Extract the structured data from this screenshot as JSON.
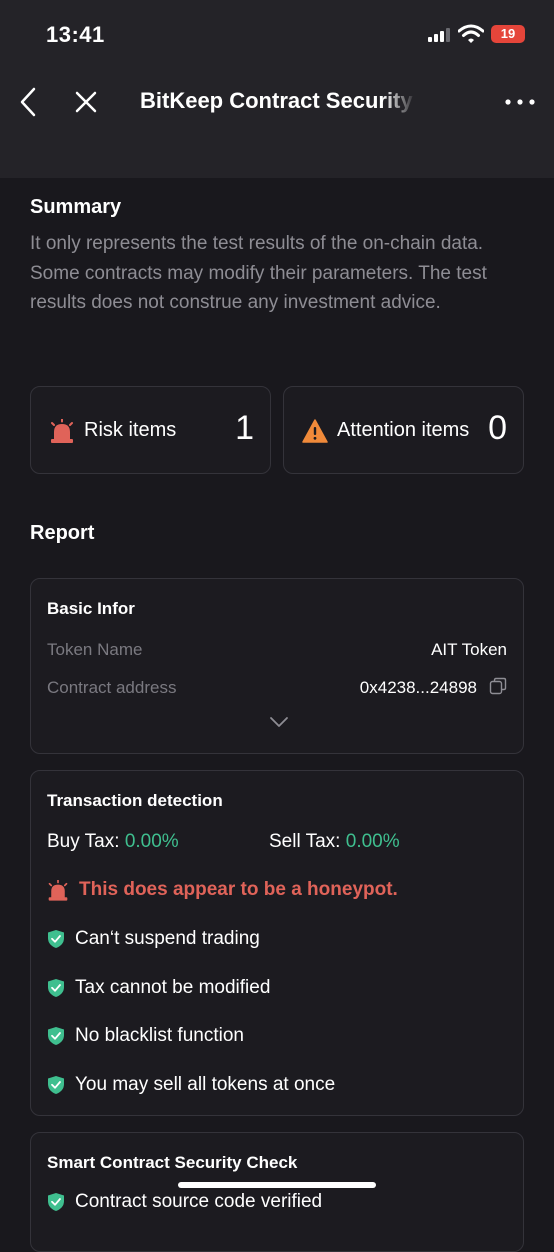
{
  "status": {
    "time": "13:41",
    "battery": "19"
  },
  "nav": {
    "title": "BitKeep Contract Security"
  },
  "summary": {
    "title": "Summary",
    "text": "It only represents the test results of the on-chain data. Some contracts may modify their parameters. The test results does not construe any investment advice."
  },
  "counts": {
    "risk_label": "Risk items",
    "risk_count": "1",
    "attention_label": "Attention items",
    "attention_count": "0"
  },
  "report": {
    "title": "Report"
  },
  "basic": {
    "title": "Basic Infor",
    "token_name_label": "Token Name",
    "token_name_value": "AIT Token",
    "contract_label": "Contract address",
    "contract_value": "0x4238...24898"
  },
  "tx": {
    "title": "Transaction detection",
    "buy_label": "Buy Tax:",
    "buy_value": "0.00%",
    "sell_label": "Sell Tax:",
    "sell_value": "0.00%",
    "honeypot": "This does appear to be a honeypot.",
    "checks": [
      "Can‘t suspend trading",
      "Tax cannot be modified",
      "No blacklist function",
      "You may sell all tokens at once"
    ]
  },
  "smart": {
    "title": "Smart Contract Security Check",
    "first_item": "Contract source code verified"
  },
  "colors": {
    "bg": "#19181d",
    "risk": "#e06359",
    "safe": "#3fbf8f",
    "warn": "#f08a3a"
  }
}
